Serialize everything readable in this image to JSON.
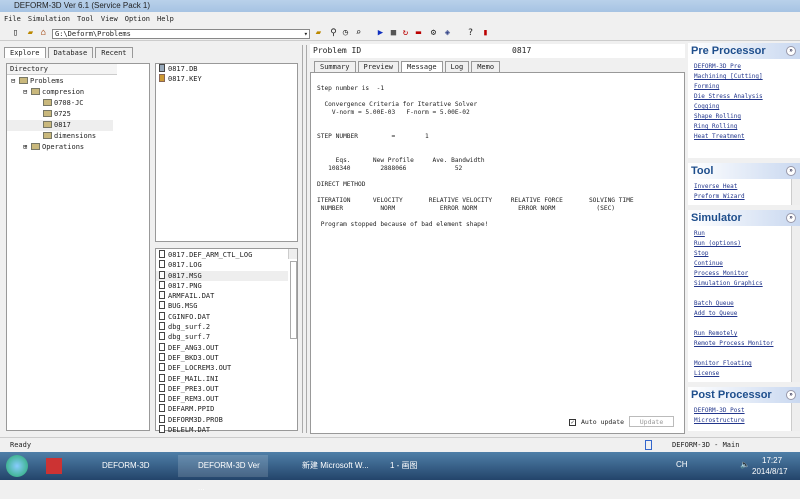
{
  "window": {
    "title": "DEFORM-3D  Ver 6.1 (Service Pack 1)"
  },
  "menu": [
    "File",
    "Simulation",
    "Tool",
    "View",
    "Option",
    "Help"
  ],
  "toolbar": {
    "path": "G:\\Deform\\Problems"
  },
  "explore_tabs": [
    "Explore",
    "Database",
    "Recent"
  ],
  "tree": {
    "header": "Directory",
    "items": [
      {
        "label": "Problems",
        "level": 0,
        "expander": "-"
      },
      {
        "label": "compresion",
        "level": 1,
        "expander": "-"
      },
      {
        "label": "0708-JC",
        "level": 2,
        "expander": ""
      },
      {
        "label": "0725",
        "level": 2,
        "expander": ""
      },
      {
        "label": "0817",
        "level": 2,
        "expander": "",
        "selected": true
      },
      {
        "label": "dimensions",
        "level": 2,
        "expander": ""
      },
      {
        "label": "Operations",
        "level": 1,
        "expander": "+"
      }
    ]
  },
  "problem_files": [
    "0817.DB",
    "0817.KEY"
  ],
  "files": [
    "0817.DEF_ARM_CTL_LOG",
    "0817.LOG",
    "0817.MSG",
    "0817.PNG",
    "ARMFAIL.DAT",
    "BUG.MSG",
    "CGINFO.DAT",
    "dbg_surf.2",
    "dbg_surf.7",
    "DEF_ANG3.OUT",
    "DEF_BKD3.OUT",
    "DEF_LOCREM3.OUT",
    "DEF_MAIL.INI",
    "DEF_PRE3.OUT",
    "DEF_REM3.OUT",
    "DEFARM.PPID",
    "DEFORM3D.PROB",
    "DELELM.DAT"
  ],
  "problem": {
    "label": "Problem ID",
    "value": "0817"
  },
  "message_tabs": [
    "Summary",
    "Preview",
    "Message",
    "Log",
    "Memo"
  ],
  "message_text": "Step number is  -1\n\n  Convergence Criteria for Iterative Solver\n    V-norm = 5.00E-03   F-norm = 5.00E-02\n\n\nSTEP NUMBER         =        1\n\n\n     Eqs.      New Profile     Ave. Bandwidth\n   108340        2888066             52\n\nDIRECT METHOD\n\nITERATION      VELOCITY       RELATIVE VELOCITY     RELATIVE FORCE       SOLVING TIME\n NUMBER          NORM            ERROR NORM           ERROR NORM           (SEC)\n\n Program stopped because of bad element shape!",
  "auto_update": {
    "label": "Auto update",
    "checked": true
  },
  "update_button": "Update",
  "sections": [
    {
      "title": "Pre Processor",
      "links": [
        "DEFORM-3D Pre",
        "Machining [Cutting]",
        "Forming",
        "Die Stress Analysis",
        "Cogging",
        "Shape Rolling",
        "Ring Rolling",
        "Heat Treatment"
      ]
    },
    {
      "title": "Tool",
      "links": [
        "Inverse Heat",
        "Preform Wizard"
      ]
    },
    {
      "title": "Simulator",
      "links": [
        "Run",
        "Run (options)",
        "Stop",
        "Continue",
        "Process Monitor",
        "Simulation Graphics",
        "",
        "Batch Queue",
        "Add to Queue",
        "",
        "Run Remotely",
        "Remote Process Monitor",
        "",
        "Monitor Floating",
        "License"
      ]
    },
    {
      "title": "Post Processor",
      "links": [
        "DEFORM-3D Post",
        "Microstructure"
      ]
    }
  ],
  "status": {
    "left": "Ready",
    "right": "DEFORM-3D  -  Main"
  },
  "taskbar": {
    "tasks": [
      "DEFORM-3D",
      "DEFORM-3D  Ver ...",
      "新建 Microsoft W...",
      "1 - 画图"
    ],
    "lang": "CH",
    "time": "17:27",
    "date": "2014/8/17"
  }
}
